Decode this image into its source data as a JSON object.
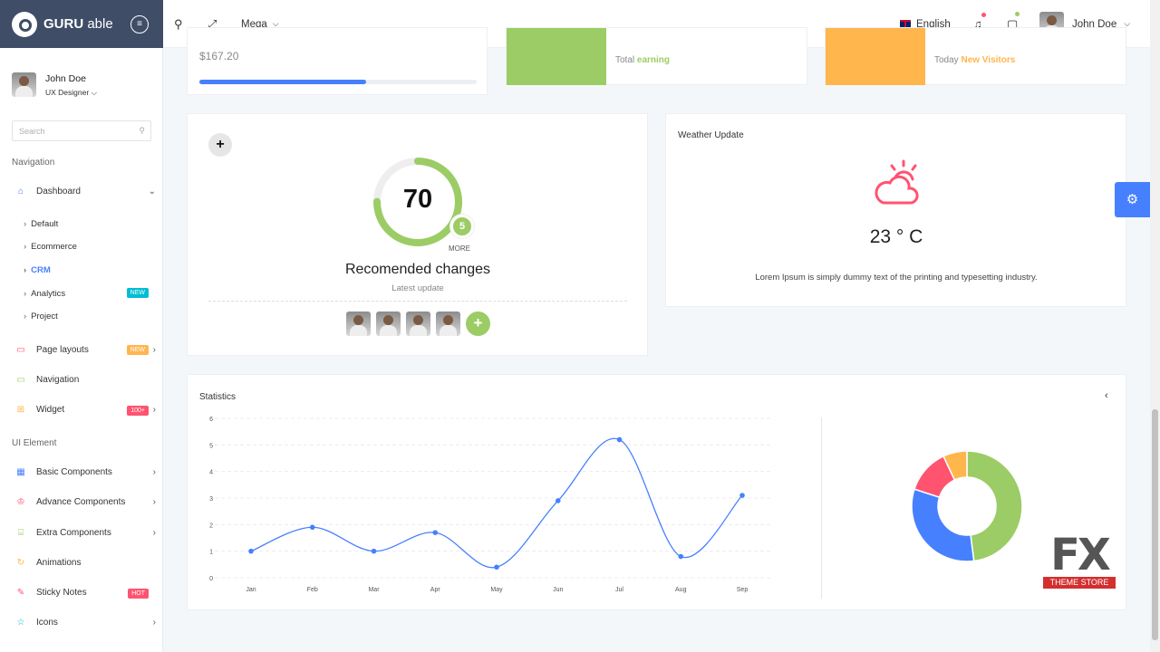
{
  "brand": {
    "name_bold": "GURU",
    "name_light": "able"
  },
  "user": {
    "name": "John Doe",
    "role": "UX Designer"
  },
  "sidebar": {
    "search_placeholder": "Search",
    "sections": {
      "navigation": "Navigation",
      "ui": "UI Element"
    },
    "dashboard": {
      "label": "Dashboard",
      "subs": [
        "Default",
        "Ecommerce",
        "CRM",
        "Analytics",
        "Project"
      ],
      "analytics_badge": "NEW"
    },
    "items": [
      {
        "label": "Page layouts",
        "badge": "NEW"
      },
      {
        "label": "Navigation"
      },
      {
        "label": "Widget",
        "badge": "100+"
      },
      {
        "label": "Basic Components"
      },
      {
        "label": "Advance Components"
      },
      {
        "label": "Extra Components"
      },
      {
        "label": "Animations"
      },
      {
        "label": "Sticky Notes",
        "badge": "HOT"
      },
      {
        "label": "Icons"
      }
    ]
  },
  "header": {
    "mega": "Mega",
    "language": "English",
    "user": "John Doe"
  },
  "top_cards": {
    "amount": "$167.20",
    "progress": 0.6,
    "earning_prefix": "Total",
    "earning_word": "earning",
    "visitors_prefix": "Today",
    "visitors_word": "New Visitors"
  },
  "gauge": {
    "value": "70",
    "more_count": "5",
    "more_label": "MORE",
    "title": "Recomended changes",
    "subtitle": "Latest update",
    "fill": 0.75,
    "add": "+"
  },
  "weather": {
    "title": "Weather Update",
    "temp": "23 ° C",
    "text": "Lorem Ipsum is simply dummy text of the printing and typesetting industry."
  },
  "statistics": {
    "title": "Statistics"
  },
  "chart_data": [
    {
      "type": "line",
      "categories": [
        "Jan",
        "Feb",
        "Mar",
        "Apr",
        "May",
        "Jun",
        "Jul",
        "Aug",
        "Sep"
      ],
      "values": [
        1,
        1.9,
        1,
        1.7,
        0.4,
        2.9,
        5.2,
        0.8,
        3.1
      ],
      "ylim": [
        0,
        6
      ],
      "yticks": [
        "0",
        "1",
        "2",
        "3",
        "4",
        "5",
        "6"
      ],
      "color": "#4680ff",
      "grid": true
    },
    {
      "type": "pie",
      "values": [
        48,
        32,
        13,
        7
      ],
      "colors": [
        "#9ccc65",
        "#4680ff",
        "#ff5370",
        "#ffb64d"
      ]
    }
  ],
  "watermark": {
    "text": "FX",
    "sub": "THEME STORE"
  }
}
